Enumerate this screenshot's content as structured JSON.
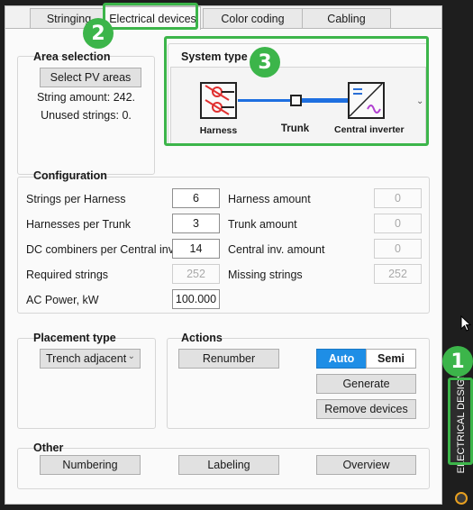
{
  "tabs": [
    {
      "label": "Stringing",
      "active": false
    },
    {
      "label": "Electrical devices",
      "active": true
    },
    {
      "label": "Color coding",
      "active": false
    },
    {
      "label": "Cabling",
      "active": false
    }
  ],
  "area_selection": {
    "title": "Area selection",
    "button": "Select PV areas",
    "string_amount": "String amount: 242.",
    "unused_strings": "Unused strings: 0."
  },
  "system_type": {
    "title": "System type",
    "labels": {
      "harness": "Harness",
      "trunk": "Trunk",
      "inverter": "Central inverter"
    },
    "dropdown_icon": "chevron-down-icon"
  },
  "configuration": {
    "title": "Configuration",
    "strings_per_harness": {
      "label": "Strings per Harness",
      "value": "6"
    },
    "harnesses_per_trunk": {
      "label": "Harnesses per Trunk",
      "value": "3"
    },
    "dc_combiners": {
      "label": "DC combiners per Central inv.",
      "value": "14"
    },
    "required_strings": {
      "label": "Required strings",
      "value": "252"
    },
    "ac_power": {
      "label": "AC Power, kW",
      "value": "100.000"
    },
    "harness_amount": {
      "label": "Harness amount",
      "value": "0"
    },
    "trunk_amount": {
      "label": "Trunk amount",
      "value": "0"
    },
    "central_inv_amount": {
      "label": "Central inv. amount",
      "value": "0"
    },
    "missing_strings": {
      "label": "Missing strings",
      "value": "252"
    }
  },
  "placement": {
    "title": "Placement type",
    "selected": "Trench adjacent"
  },
  "actions": {
    "title": "Actions",
    "renumber": "Renumber",
    "auto": "Auto",
    "semi": "Semi",
    "generate": "Generate",
    "remove": "Remove devices"
  },
  "other": {
    "title": "Other",
    "numbering": "Numbering",
    "labeling": "Labeling",
    "overview": "Overview"
  },
  "side_tab": {
    "label": "ELECTRICAL DESIGN"
  },
  "badges": [
    "1",
    "2",
    "3"
  ],
  "colors": {
    "accent_green": "#3cb54a",
    "selected_blue": "#1e8ee6",
    "inverter_blue": "#2a6fd6",
    "wire_blue": "#1e6fe0",
    "harness_red": "#e03030"
  }
}
